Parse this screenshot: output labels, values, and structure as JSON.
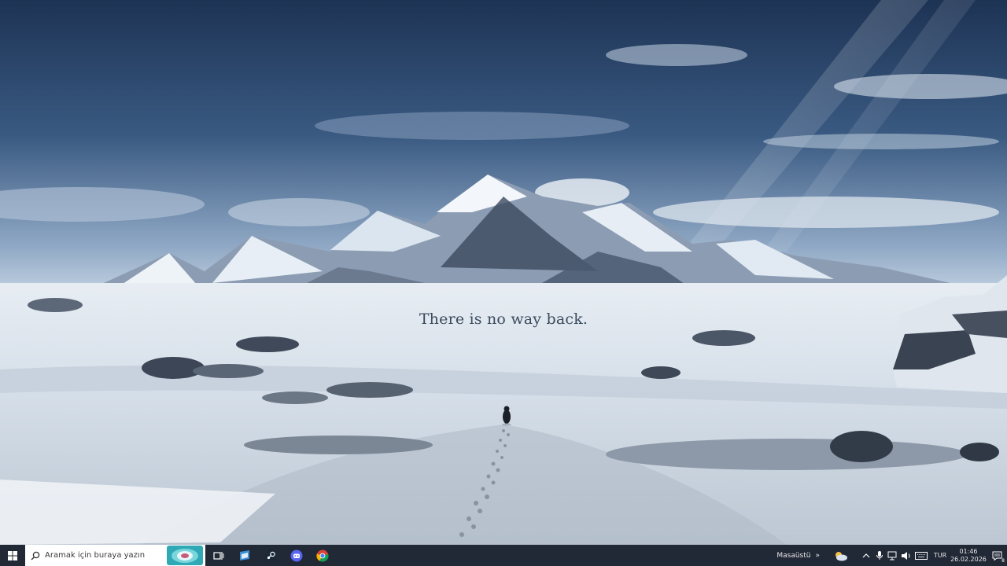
{
  "wallpaper": {
    "caption": "There is no way back."
  },
  "taskbar": {
    "search_placeholder": "Aramak için buraya yazın",
    "apps": [
      {
        "name": "task-view-icon"
      },
      {
        "name": "visual-studio-installer-icon"
      },
      {
        "name": "steam-icon"
      },
      {
        "name": "discord-icon"
      },
      {
        "name": "chrome-icon"
      }
    ],
    "desktop_label": "Masaüstü",
    "overflow_glyph": "»",
    "language": "TUR",
    "time": "01:46",
    "date": "26.02.2026",
    "notification_count": "8"
  },
  "colors": {
    "taskbar_bg": "#212836",
    "search_bg": "#ffffff",
    "discord": "#5865f2",
    "steam": "#1b2838"
  }
}
